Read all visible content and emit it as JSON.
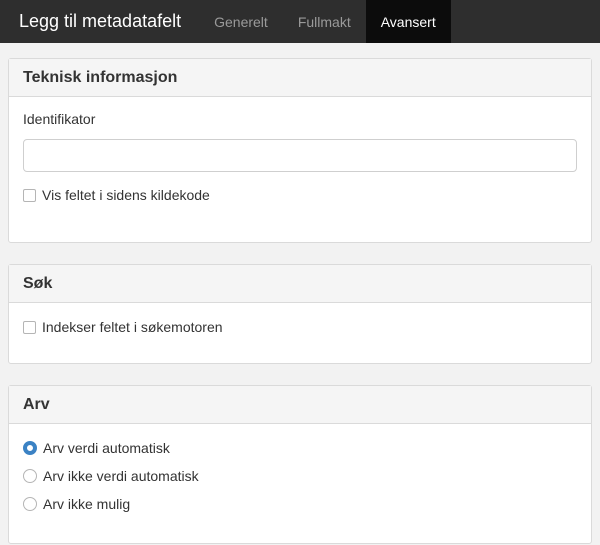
{
  "header": {
    "title": "Legg til metadatafelt",
    "tabs": [
      {
        "label": "Generelt",
        "active": false
      },
      {
        "label": "Fullmakt",
        "active": false
      },
      {
        "label": "Avansert",
        "active": true
      }
    ]
  },
  "technical": {
    "heading": "Teknisk informasjon",
    "identifier_label": "Identifikator",
    "identifier_value": "",
    "show_in_source_label": "Vis feltet i sidens kildekode",
    "show_in_source_checked": false
  },
  "search": {
    "heading": "Søk",
    "index_label": "Indekser feltet i søkemotoren",
    "index_checked": false
  },
  "inheritance": {
    "heading": "Arv",
    "options": [
      {
        "label": "Arv verdi automatisk",
        "selected": true
      },
      {
        "label": "Arv ikke verdi automatisk",
        "selected": false
      },
      {
        "label": "Arv ikke mulig",
        "selected": false
      }
    ]
  },
  "colors": {
    "topbar": "#2e2e2e",
    "active_tab": "#0c0c0c",
    "radio_accent": "#3b82c4"
  }
}
